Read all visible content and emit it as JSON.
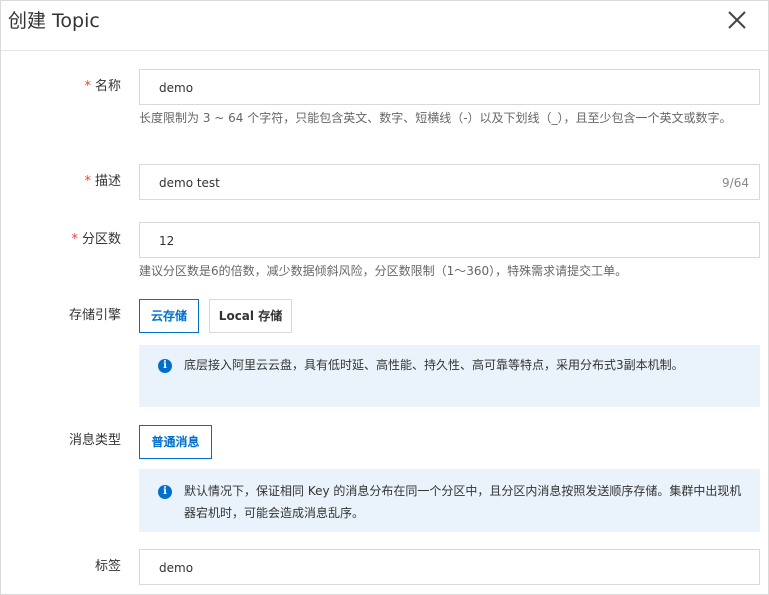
{
  "dialog": {
    "title": "创建 Topic",
    "close_icon": "close-icon"
  },
  "form": {
    "name": {
      "required": true,
      "label": "名称",
      "value": "demo",
      "help": "长度限制为 3 ~ 64 个字符，只能包含英文、数字、短横线（-）以及下划线（_），且至少包含一个英文或数字。"
    },
    "description": {
      "required": true,
      "label": "描述",
      "value": "demo test",
      "counter": "9/64"
    },
    "partitions": {
      "required": true,
      "label": "分区数",
      "value": "12",
      "help": "建议分区数是6的倍数，减少数据倾斜风险，分区数限制（1～360），特殊需求请提交工单。"
    },
    "storage": {
      "label": "存储引擎",
      "options": [
        "云存储",
        "Local 存储"
      ],
      "selected": "云存储",
      "notice": "底层接入阿里云云盘，具有低时延、高性能、持久性、高可靠等特点，采用分布式3副本机制。"
    },
    "message_type": {
      "label": "消息类型",
      "options": [
        "普通消息"
      ],
      "selected": "普通消息",
      "notice": "默认情况下，保证相同 Key 的消息分布在同一个分区中，且分区内消息按照发送顺序存储。集群中出现机器宕机时，可能会造成消息乱序。"
    },
    "tags": {
      "label": "标签",
      "value": "demo"
    }
  },
  "required_mark": "*",
  "info_icon": "info-icon",
  "colors": {
    "accent": "#0070cc",
    "required": "#f04134",
    "notice_bg": "#eaf3fb",
    "border": "#d9d9d9"
  }
}
